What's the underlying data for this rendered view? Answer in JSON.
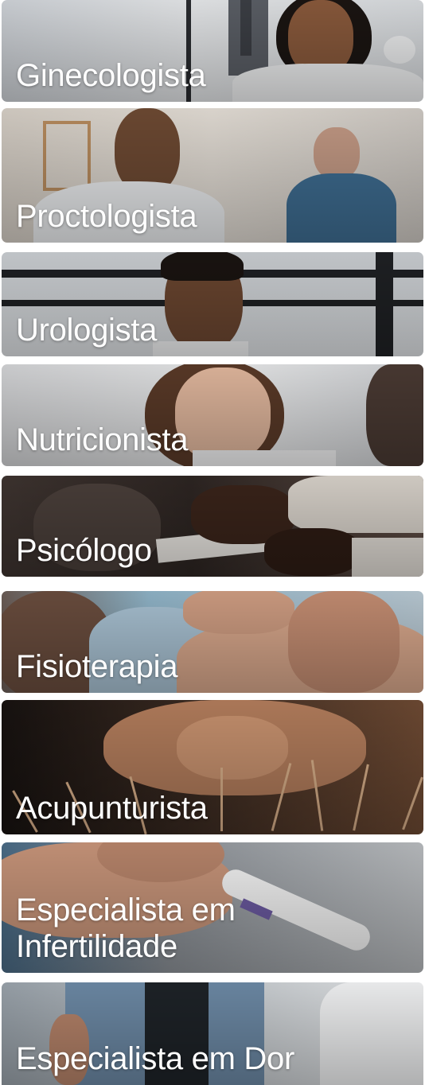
{
  "specialties": [
    {
      "label": "Ginecologista"
    },
    {
      "label": "Proctologista"
    },
    {
      "label": "Urologista"
    },
    {
      "label": "Nutricionista"
    },
    {
      "label": "Psicólogo"
    },
    {
      "label": "Fisioterapia"
    },
    {
      "label": "Acupunturista"
    },
    {
      "label": "Especialista em\nInfertilidade"
    },
    {
      "label": "Especialista em Dor"
    }
  ],
  "colors": {
    "label_text": "#ffffff",
    "background": "#ffffff"
  }
}
